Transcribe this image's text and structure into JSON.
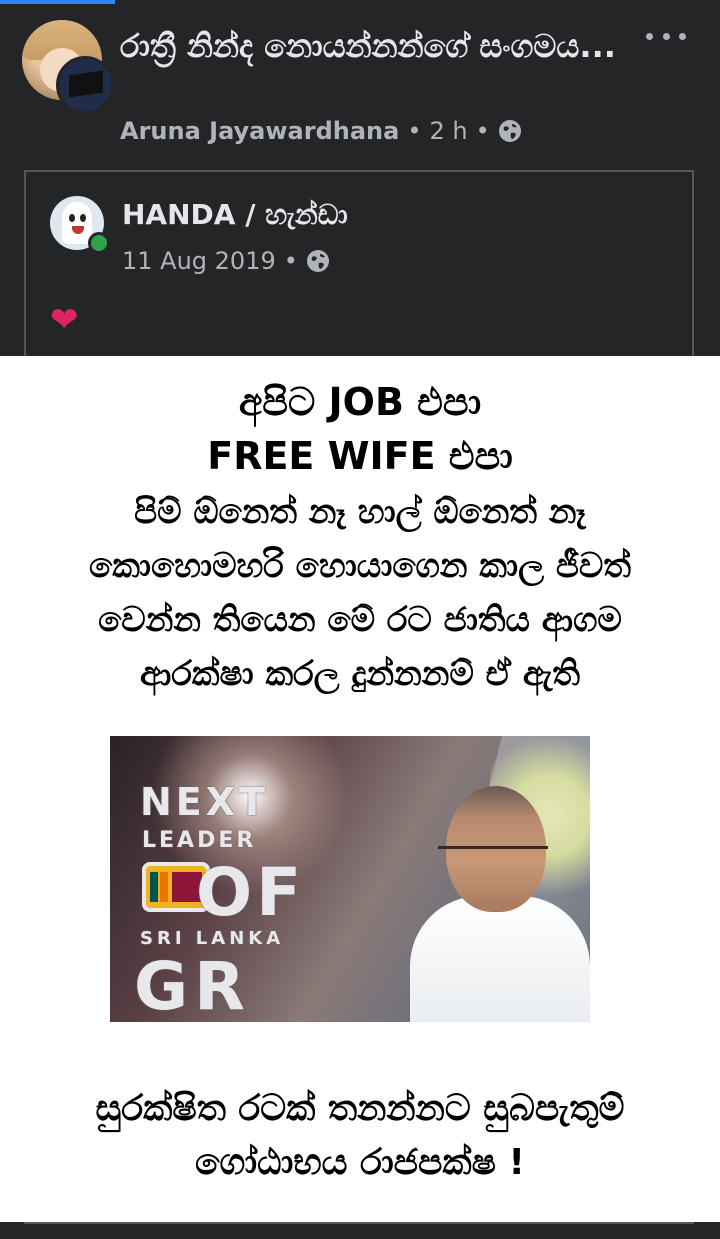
{
  "group": {
    "title": "රාත්‍රී නින්ද නොයන්නන්ගේ සංගමය...",
    "author": "Aruna Jayawardhana",
    "separator": "•",
    "time": "2 h",
    "privacy_icon": "globe-icon",
    "more_icon": "more-options-icon"
  },
  "shared": {
    "page_name": "HANDA / හැන්ඩා",
    "date": "11 Aug 2019",
    "separator": "•",
    "privacy_icon": "globe-icon",
    "reaction": "❤",
    "online_color": "#31a24c"
  },
  "meme": {
    "line1": "අපිට JOB එපා",
    "line2": "FREE WIFE එපා",
    "line3": "පිම් ඕනෙත් නෑ හාල් ඕනෙත් නෑ",
    "line4": "කොහොමහරි හොයාගෙන කාල ජීවත්",
    "line5": "වෙන්න තියෙන මේ රට ජාතිය ආගම",
    "line6": "ආරක්ෂා කරල දුන්නනම් ඒ ඇති",
    "photo": {
      "next": "NEXT",
      "leader": "LEADER",
      "of": "OF",
      "sri_lanka": "SRI LANKA",
      "gr": "GR"
    },
    "line7": "සුරක්ෂිත රටක් තනන්නට සුබපැතුම්",
    "line8": "ගෝඨාභය රාජපක්ෂ !"
  },
  "colors": {
    "background": "#242526",
    "accent": "#2d88ff",
    "reaction": "#e0245e"
  }
}
